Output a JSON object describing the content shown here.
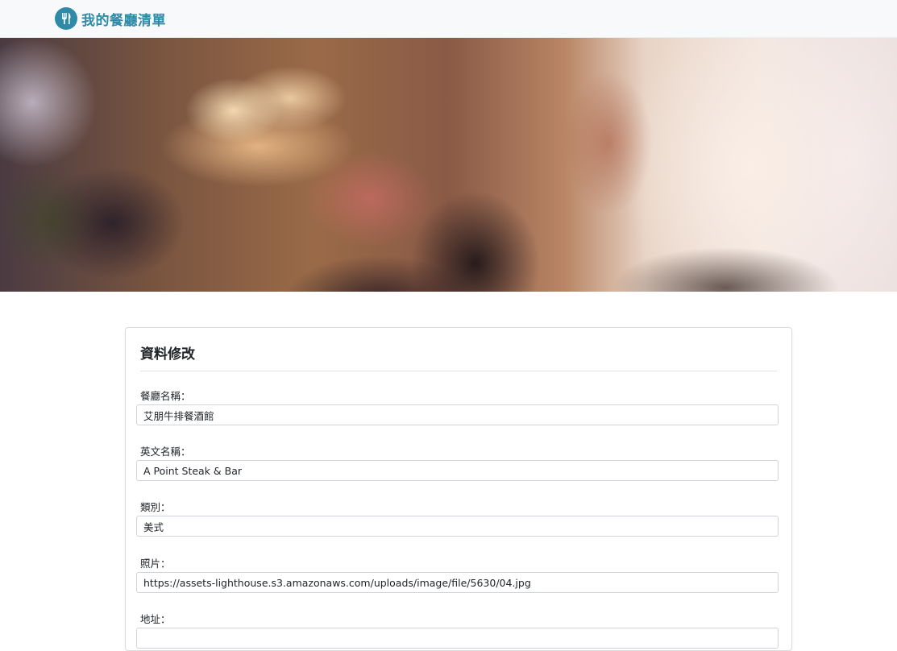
{
  "navbar": {
    "brand_title": "我的餐廳清單",
    "brand_icon": "utensils-icon",
    "brand_color": "#2e8aa6"
  },
  "hero": {
    "image": "blurred-restaurant-photo"
  },
  "form": {
    "title": "資料修改",
    "fields": [
      {
        "label": "餐廳名稱：",
        "value": "艾朋牛排餐酒館"
      },
      {
        "label": "英文名稱：",
        "value": "A Point Steak & Bar"
      },
      {
        "label": "類別：",
        "value": "美式"
      },
      {
        "label": "照片：",
        "value": "https://assets-lighthouse.s3.amazonaws.com/uploads/image/file/5630/04.jpg"
      },
      {
        "label": "地址：",
        "value": ""
      }
    ]
  }
}
